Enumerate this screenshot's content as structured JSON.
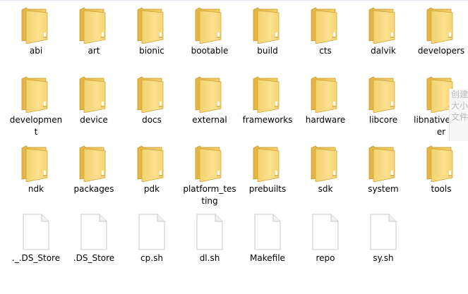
{
  "items": [
    {
      "label": "abi",
      "type": "folder"
    },
    {
      "label": "art",
      "type": "folder"
    },
    {
      "label": "bionic",
      "type": "folder"
    },
    {
      "label": "bootable",
      "type": "folder"
    },
    {
      "label": "build",
      "type": "folder"
    },
    {
      "label": "cts",
      "type": "folder"
    },
    {
      "label": "dalvik",
      "type": "folder-white"
    },
    {
      "label": "developers",
      "type": "folder"
    },
    {
      "label": "development",
      "type": "folder"
    },
    {
      "label": "device",
      "type": "folder-docs"
    },
    {
      "label": "docs",
      "type": "folder"
    },
    {
      "label": "external",
      "type": "folder"
    },
    {
      "label": "frameworks",
      "type": "folder"
    },
    {
      "label": "hardware",
      "type": "folder-docs"
    },
    {
      "label": "libcore",
      "type": "folder-white"
    },
    {
      "label": "libnativehelper",
      "type": "folder"
    },
    {
      "label": "ndk",
      "type": "folder"
    },
    {
      "label": "packages",
      "type": "folder"
    },
    {
      "label": "pdk",
      "type": "folder-white"
    },
    {
      "label": "platform_testing",
      "type": "folder"
    },
    {
      "label": "prebuilts",
      "type": "folder"
    },
    {
      "label": "sdk",
      "type": "folder"
    },
    {
      "label": "system",
      "type": "folder-docs"
    },
    {
      "label": "tools",
      "type": "folder"
    },
    {
      "label": "._.DS_Store",
      "type": "file"
    },
    {
      "label": ".DS_Store",
      "type": "file"
    },
    {
      "label": "cp.sh",
      "type": "file"
    },
    {
      "label": "dl.sh",
      "type": "file"
    },
    {
      "label": "Makefile",
      "type": "file"
    },
    {
      "label": "repo",
      "type": "file"
    },
    {
      "label": "sy.sh",
      "type": "file"
    }
  ],
  "tooltip": {
    "lines": [
      "创建",
      "大小",
      "文件"
    ]
  },
  "colors": {
    "folder_front": "#f7d774",
    "folder_back": "#e7bb45",
    "file_fill": "#ffffff",
    "file_stroke": "#c8c8c8"
  }
}
